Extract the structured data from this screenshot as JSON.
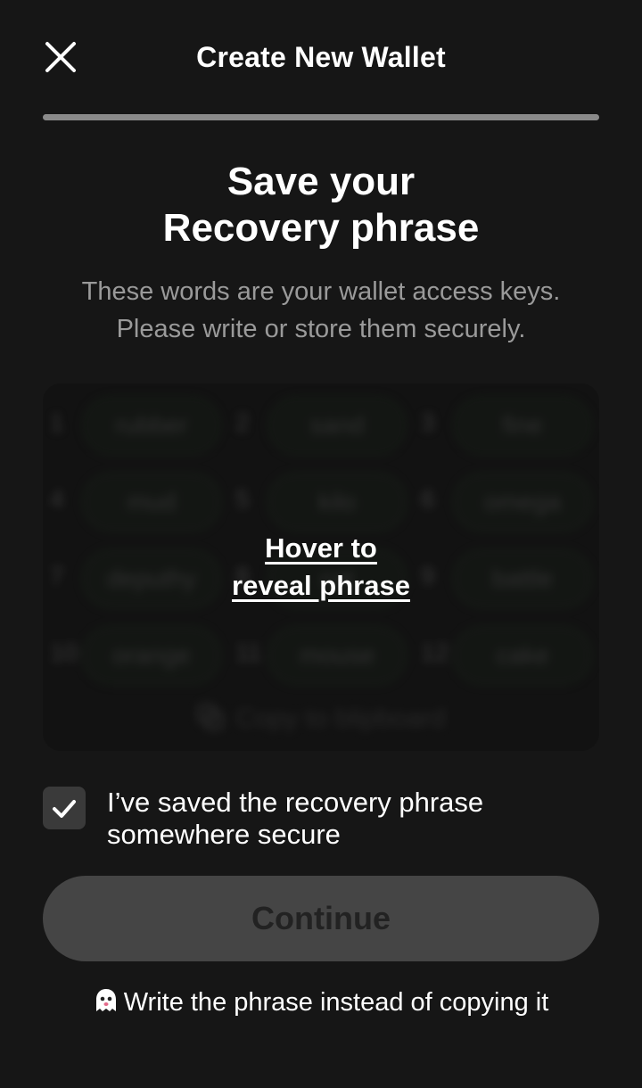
{
  "header": {
    "title": "Create New Wallet",
    "close_icon": "close-icon",
    "progress": 1.0
  },
  "main": {
    "title_line1": "Save your",
    "title_line2": "Recovery phrase",
    "subtitle_line1": "These words are your wallet access keys.",
    "subtitle_line2": "Please write or store them securely."
  },
  "phrase": {
    "words": [
      {
        "num": "1",
        "word": "rubber"
      },
      {
        "num": "2",
        "word": "sand"
      },
      {
        "num": "3",
        "word": "fine"
      },
      {
        "num": "4",
        "word": "mud"
      },
      {
        "num": "5",
        "word": "kilo"
      },
      {
        "num": "6",
        "word": "omega"
      },
      {
        "num": "7",
        "word": "deputhy"
      },
      {
        "num": "8",
        "word": "cat"
      },
      {
        "num": "9",
        "word": "battle"
      },
      {
        "num": "10",
        "word": "orange"
      },
      {
        "num": "11",
        "word": "mouse"
      },
      {
        "num": "12",
        "word": "cake"
      }
    ],
    "copy_label": "Copy to blipboard",
    "reveal_line1": "Hover to",
    "reveal_line2": "reveal phrase"
  },
  "confirm": {
    "checked": true,
    "label_line1": "I’ve saved the recovery phrase",
    "label_line2": "somewhere secure"
  },
  "continue_label": "Continue",
  "hint": {
    "icon": "ghost-icon",
    "text": "Write the phrase instead of copying it"
  },
  "colors": {
    "background": "#161616",
    "button_disabled": "#454545",
    "subtitle": "#9a9a9a"
  }
}
